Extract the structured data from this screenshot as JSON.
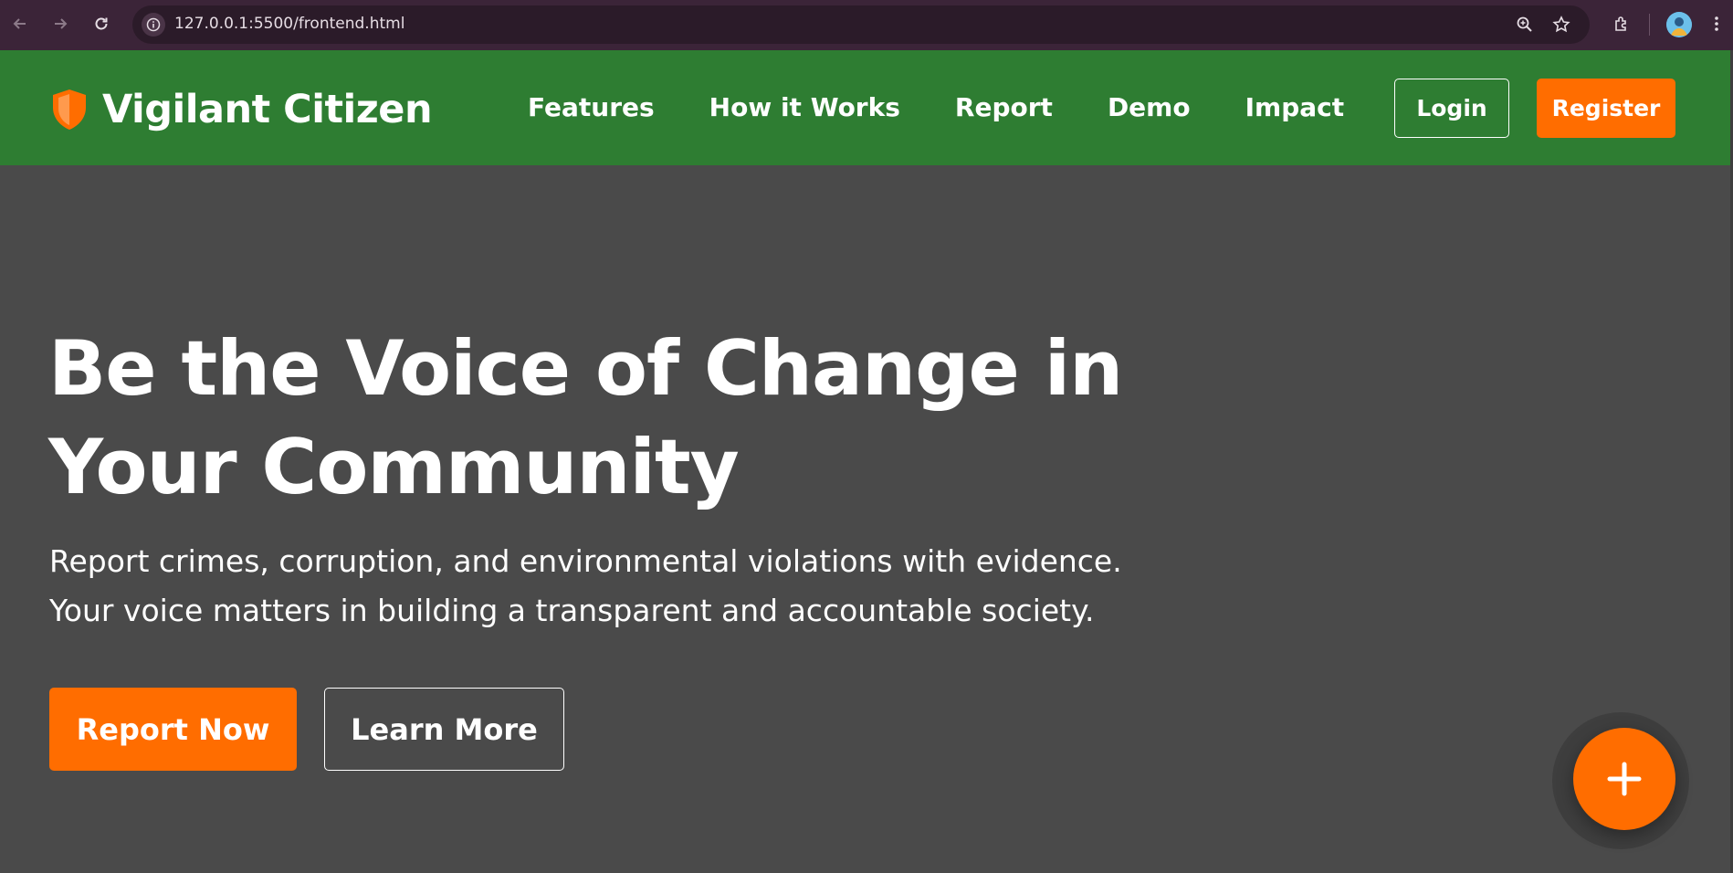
{
  "browser": {
    "url": "127.0.0.1:5500/frontend.html",
    "icons": [
      "back-icon",
      "forward-icon",
      "reload-icon",
      "site-info-icon",
      "zoom-icon",
      "bookmark-star-icon",
      "extensions-icon",
      "profile-avatar",
      "more-menu-icon"
    ]
  },
  "navbar": {
    "brand": "Vigilant Citizen",
    "brand_icon": "shield-icon",
    "links": [
      "Features",
      "How it Works",
      "Report",
      "Demo",
      "Impact"
    ],
    "login_label": "Login",
    "register_label": "Register",
    "background_color": "#2e7d32",
    "accent_color": "#ff6d00"
  },
  "hero": {
    "title_line1": "Be the Voice of Change in",
    "title_line2": "Your Community",
    "subtitle_line1": "Report crimes, corruption, and environmental violations with evidence.",
    "subtitle_line2": "Your voice matters in building a transparent and accountable society.",
    "primary_button": "Report Now",
    "secondary_button": "Learn More",
    "background_color": "#4a4a4a"
  },
  "fab": {
    "icon": "plus-icon",
    "color": "#ff6d00"
  }
}
